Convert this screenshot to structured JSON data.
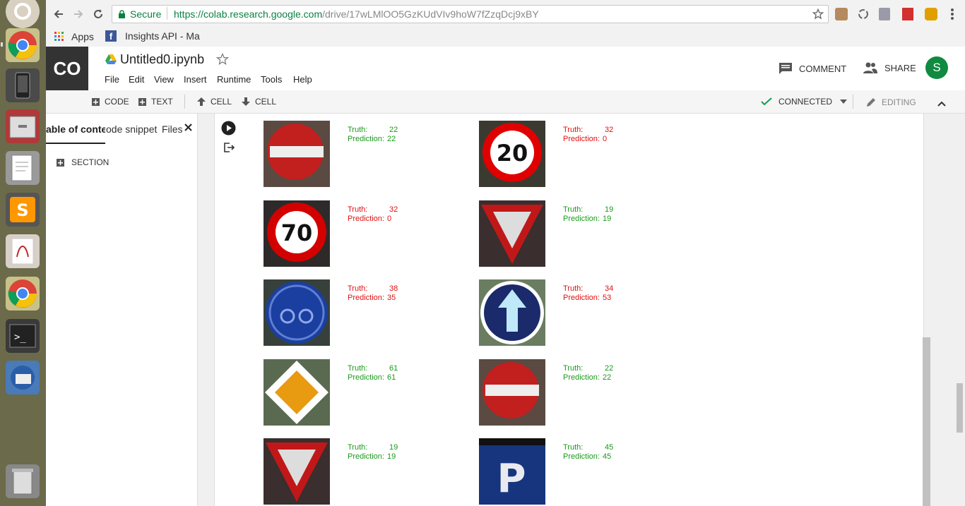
{
  "launcher": {
    "items": [
      "ubuntu-icon",
      "chrome-icon",
      "phone-icon",
      "files-icon",
      "text-editor-icon",
      "sublime-icon",
      "document-viewer-icon",
      "chrome-icon",
      "terminal-icon",
      "thunderbird-icon",
      "trash-icon"
    ]
  },
  "browser": {
    "secure_label": "Secure",
    "url_host": "https://colab.research.google.com",
    "url_path": "/drive/17wLMlOO5GzKUdVIv9hoW7fZzqDcj9xBY",
    "bookmarks": {
      "apps": "Apps",
      "insights": "Insights API - Ma"
    }
  },
  "colab": {
    "logo": "CO",
    "title": "Untitled0.ipynb",
    "menu": [
      "File",
      "Edit",
      "View",
      "Insert",
      "Runtime",
      "Tools",
      "Help"
    ],
    "comment": "COMMENT",
    "share": "SHARE",
    "avatar": "S"
  },
  "toolbar": {
    "code": "CODE",
    "text": "TEXT",
    "cell_up": "CELL",
    "cell_down": "CELL",
    "connected": "CONNECTED",
    "editing": "EDITING"
  },
  "sidebar": {
    "tabs": [
      "able of conten",
      "ode snippet",
      "Files"
    ],
    "section": "SECTION"
  },
  "colors": {
    "correct": "#1a9a1a",
    "wrong": "#e01010",
    "accent_green": "#0f9d58"
  },
  "predictions": [
    {
      "truth": "22",
      "prediction": "22",
      "correct": true,
      "sign": "no-entry"
    },
    {
      "truth": "32",
      "prediction": "0",
      "correct": false,
      "sign": "speed-20"
    },
    {
      "truth": "32",
      "prediction": "0",
      "correct": false,
      "sign": "speed-70"
    },
    {
      "truth": "19",
      "prediction": "19",
      "correct": true,
      "sign": "yield"
    },
    {
      "truth": "38",
      "prediction": "35",
      "correct": false,
      "sign": "bicycle"
    },
    {
      "truth": "34",
      "prediction": "53",
      "correct": false,
      "sign": "ahead-only"
    },
    {
      "truth": "61",
      "prediction": "61",
      "correct": true,
      "sign": "priority-road"
    },
    {
      "truth": "22",
      "prediction": "22",
      "correct": true,
      "sign": "no-entry"
    },
    {
      "truth": "19",
      "prediction": "19",
      "correct": true,
      "sign": "yield"
    },
    {
      "truth": "45",
      "prediction": "45",
      "correct": true,
      "sign": "parking"
    }
  ],
  "truth_label": "Truth:",
  "prediction_label": "Prediction:"
}
